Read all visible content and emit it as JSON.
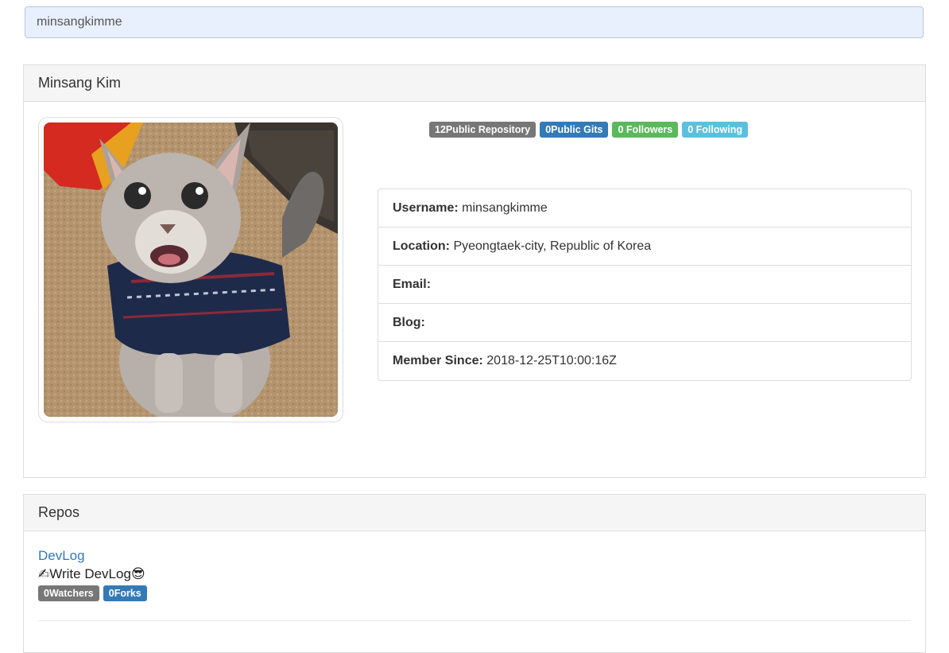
{
  "search": {
    "value": "minsangkimme"
  },
  "profile": {
    "name": "Minsang Kim",
    "avatar_alt": "avatar",
    "badges": {
      "repos": "12Public Repository",
      "gists": "0Public Gits",
      "followers": "0 Followers",
      "following": "0 Following"
    },
    "info": {
      "username_label": "Username:",
      "username_value": "minsangkimme",
      "location_label": "Location:",
      "location_value": "Pyeongtaek-city, Republic of Korea",
      "email_label": "Email:",
      "email_value": "",
      "blog_label": "Blog:",
      "blog_value": "",
      "member_label": "Member Since:",
      "member_value": "2018-12-25T10:00:16Z"
    }
  },
  "repos": {
    "title": "Repos",
    "items": [
      {
        "name": "DevLog",
        "desc_emoji_1": "✍",
        "desc_text": "Write DevLog",
        "desc_emoji_2": "😎",
        "watchers": "0Watchers",
        "forks": "0Forks"
      }
    ]
  }
}
